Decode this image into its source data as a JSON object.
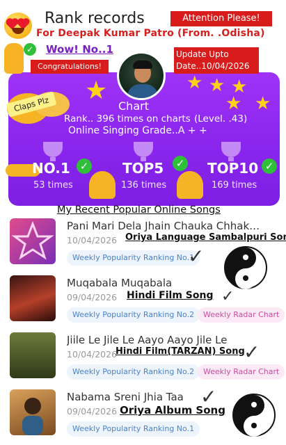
{
  "header": {
    "title": "Rank records",
    "attention": "Attention Please!",
    "owner": "For Deepak Kumar Patro (From. .Odisha)"
  },
  "badges": {
    "wow": "Wow! No..1",
    "congratulations": "Congratulations!",
    "update": "Update Upto Date..10/04/2026",
    "claps": "Claps Plz"
  },
  "chart": {
    "label": "Chart",
    "rank_line": "Rank.. 396 times on charts",
    "level": "(Level. .43)",
    "grade": "Online Singing Grade..A + +"
  },
  "stats": [
    {
      "label": "NO.1",
      "times": "53 times"
    },
    {
      "label": "TOP5",
      "times": "136 times"
    },
    {
      "label": "TOP10",
      "times": "169 times"
    }
  ],
  "recent": {
    "heading": "My Recent Popular Online Songs",
    "songs": [
      {
        "title": "Pani Mari Dela Jhain Chauka Chhak…",
        "date": "10/04/2026",
        "note": "Oriya Language Sambalpuri Song",
        "tags": [
          "Weekly Popularity Ranking No.1"
        ]
      },
      {
        "title": "Muqabala Muqabala",
        "date": "09/04/2026",
        "note": "Hindi Film Song",
        "tags": [
          "Weekly Popularity Ranking No.2",
          "Weekly Radar Chart"
        ]
      },
      {
        "title": "Jiile Le Jile Le Aayo Aayo Jile Le",
        "date": "10/04/2026",
        "note": "Hindi Film(TARZAN) Song",
        "tags": [
          "Weekly Popularity Ranking No.2",
          "Weekly Radar Chart"
        ]
      },
      {
        "title": "Nabama Sreni Jhia Taa",
        "date": "09/04/2026",
        "note": "Oriya Album Song",
        "tags": [
          "Weekly Popularity Ranking No.1"
        ]
      }
    ]
  },
  "colors": {
    "purple": "#8a25ee",
    "red": "#d81b1b",
    "green": "#2fbf3b",
    "gold": "#ffd21a"
  },
  "icons": [
    "heart-eyes-emoji",
    "thumbs-up-icon",
    "check-icon",
    "star-icon",
    "trophy-icon",
    "clapping-hands-icon",
    "praying-hands-icon",
    "pointing-hand-icon",
    "yin-yang-icon",
    "tick-mark-icon"
  ]
}
